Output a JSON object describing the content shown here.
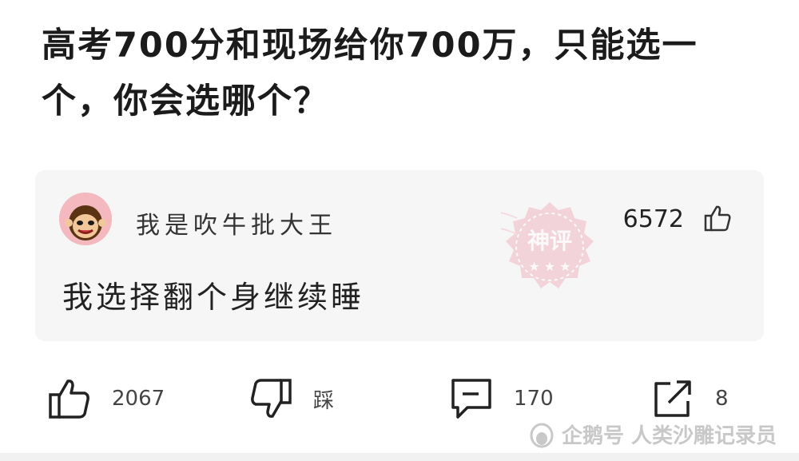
{
  "post": {
    "title": "高考700分和现场给你700万，只能选一个，你会选哪个？"
  },
  "top_comment": {
    "username": "我是吹牛批大王",
    "like_count": "6572",
    "text": "我选择翻个身继续睡",
    "stamp_text": "神评"
  },
  "actions": {
    "like_count": "2067",
    "dislike_label": "踩",
    "comment_count": "170",
    "share_count": "8"
  },
  "watermark": {
    "text": "企鹅号 人类沙雕记录员"
  },
  "colors": {
    "stamp": "#e8738a",
    "avatar_bg": "#f3b9bf",
    "card_bg": "#f6f6f6"
  }
}
